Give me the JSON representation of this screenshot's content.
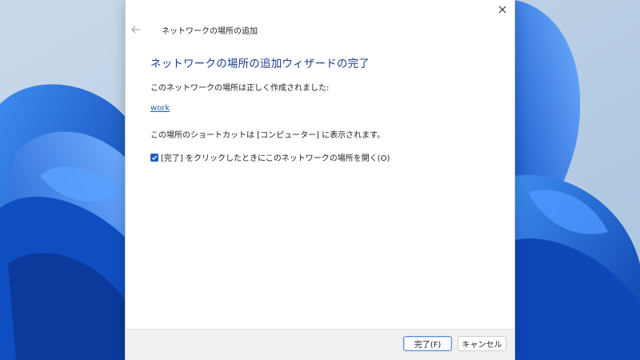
{
  "dialog": {
    "header_title": "ネットワークの場所の追加",
    "wizard_heading": "ネットワークの場所の追加ウィザードの完了",
    "success_text": "このネットワークの場所は正しく作成されました:",
    "location_name": "work",
    "shortcut_text": "この場所のショートカットは [コンピューター] に表示されます。",
    "open_checkbox": {
      "label": "[完了] をクリックしたときにこのネットワークの場所を開く(O)",
      "checked": true
    },
    "buttons": {
      "finish_label": "完了(F)",
      "cancel_label": "キャンセル"
    }
  },
  "colors": {
    "accent": "#1f5fb8",
    "heading": "#1c3d8f",
    "link": "#1a5fb4"
  },
  "icons": {
    "close": "close-icon",
    "back": "back-arrow-icon",
    "check": "checkmark-icon"
  }
}
